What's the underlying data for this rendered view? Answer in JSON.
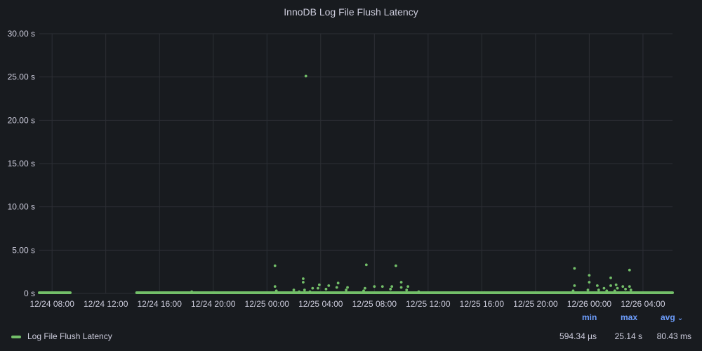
{
  "panel": {
    "title": "InnoDB Log File Flush Latency"
  },
  "legend": {
    "headers": {
      "min": "min",
      "max": "max",
      "avg": "avg"
    },
    "series_name": "Log File Flush Latency",
    "values": {
      "min": "594.34 µs",
      "max": "25.14 s",
      "avg": "80.43 ms"
    }
  },
  "colors": {
    "series": "#73bf69",
    "grid": "#2c2f35",
    "axis_text": "#ccccdc",
    "legend_header": "#6e9fff",
    "background": "#181b1f"
  },
  "chart_data": {
    "type": "scatter",
    "title": "InnoDB Log File Flush Latency",
    "ylim": [
      0,
      30
    ],
    "y_unit": "s",
    "y_ticks": [
      "0 s",
      "5.00 s",
      "10.00 s",
      "15.00 s",
      "20.00 s",
      "25.00 s",
      "30.00 s"
    ],
    "y_tick_values": [
      0,
      5,
      10,
      15,
      20,
      25,
      30
    ],
    "x_ticks": [
      "12/24 08:00",
      "12/24 12:00",
      "12/24 16:00",
      "12/24 20:00",
      "12/25 00:00",
      "12/25 04:00",
      "12/25 08:00",
      "12/25 12:00",
      "12/25 16:00",
      "12/25 20:00",
      "12/26 00:00",
      "12/26 04:00"
    ],
    "x_tick_hours": [
      8,
      12,
      16,
      20,
      24,
      28,
      32,
      36,
      40,
      44,
      48,
      52
    ],
    "xlim_hours": [
      7.05,
      54.2
    ],
    "x_hours_note": "hours from 12/24 00:00",
    "series": [
      {
        "name": "Log File Flush Latency",
        "baseline_segments": [
          [
            7.05,
            9.35
          ],
          [
            14.3,
            54.2
          ]
        ],
        "points": [
          [
            24.6,
            3.2
          ],
          [
            24.6,
            0.8
          ],
          [
            24.7,
            0.3
          ],
          [
            26.0,
            0.4
          ],
          [
            26.7,
            1.7
          ],
          [
            26.7,
            1.3
          ],
          [
            26.8,
            0.4
          ],
          [
            26.4,
            0.2
          ],
          [
            27.4,
            0.6
          ],
          [
            27.2,
            0.2
          ],
          [
            27.9,
            1.0
          ],
          [
            27.8,
            0.6
          ],
          [
            28.6,
            0.9
          ],
          [
            28.4,
            0.5
          ],
          [
            29.3,
            1.2
          ],
          [
            29.2,
            0.7
          ],
          [
            30.0,
            0.7
          ],
          [
            29.9,
            0.4
          ],
          [
            31.3,
            0.6
          ],
          [
            31.2,
            0.3
          ],
          [
            26.9,
            25.1
          ],
          [
            31.4,
            3.3
          ],
          [
            32.0,
            0.8
          ],
          [
            32.6,
            0.8
          ],
          [
            33.3,
            0.8
          ],
          [
            33.2,
            0.5
          ],
          [
            33.6,
            3.2
          ],
          [
            34.0,
            1.3
          ],
          [
            34.0,
            0.7
          ],
          [
            34.5,
            0.8
          ],
          [
            34.4,
            0.4
          ],
          [
            35.3,
            0.2
          ],
          [
            39.4,
            0.1
          ],
          [
            40.2,
            0.1
          ],
          [
            20.1,
            0.1
          ],
          [
            18.4,
            0.2
          ],
          [
            15.8,
            0.1
          ],
          [
            46.9,
            2.9
          ],
          [
            46.9,
            0.9
          ],
          [
            46.8,
            0.3
          ],
          [
            48.0,
            2.1
          ],
          [
            48.0,
            1.3
          ],
          [
            47.9,
            0.4
          ],
          [
            48.6,
            0.9
          ],
          [
            48.7,
            0.4
          ],
          [
            49.1,
            0.6
          ],
          [
            49.6,
            1.8
          ],
          [
            49.6,
            0.9
          ],
          [
            50.0,
            1.0
          ],
          [
            50.1,
            0.6
          ],
          [
            49.9,
            0.3
          ],
          [
            50.5,
            0.8
          ],
          [
            50.7,
            0.5
          ],
          [
            51.0,
            2.7
          ],
          [
            51.0,
            0.8
          ],
          [
            51.1,
            0.4
          ],
          [
            49.3,
            0.3
          ]
        ]
      }
    ]
  }
}
